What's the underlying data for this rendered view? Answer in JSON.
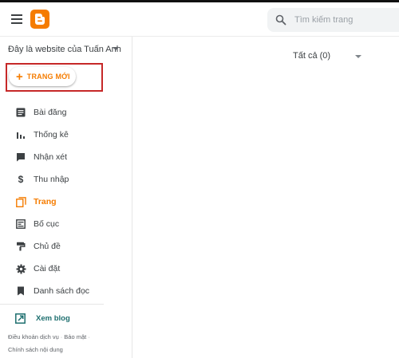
{
  "header": {
    "menu_icon": "hamburger-menu-icon",
    "logo_icon": "blogger-logo-icon",
    "brand_color": "#f57c00",
    "search_placeholder": "Tìm kiếm trang"
  },
  "sidebar": {
    "blog_name": "Đây là website của Tuấn Anh",
    "new_page_label": "TRANG MỚI",
    "items": [
      {
        "label": "Bài đăng",
        "icon": "posts-icon"
      },
      {
        "label": "Thống kê",
        "icon": "stats-icon"
      },
      {
        "label": "Nhận xét",
        "icon": "comments-icon"
      },
      {
        "label": "Thu nhập",
        "icon": "earnings-icon"
      },
      {
        "label": "Trang",
        "icon": "pages-icon",
        "active": true
      },
      {
        "label": "Bố cục",
        "icon": "layout-icon"
      },
      {
        "label": "Chủ đề",
        "icon": "theme-icon"
      },
      {
        "label": "Cài đặt",
        "icon": "settings-icon"
      },
      {
        "label": "Danh sách đọc",
        "icon": "reading-list-icon"
      }
    ],
    "view_blog_label": "Xem blog",
    "footer": {
      "terms": "Điều khoản dịch vụ",
      "privacy": "Bảo mật",
      "content_policy": "Chính sách nội dung"
    }
  },
  "main": {
    "filter_label": "Tất cả (0)"
  }
}
